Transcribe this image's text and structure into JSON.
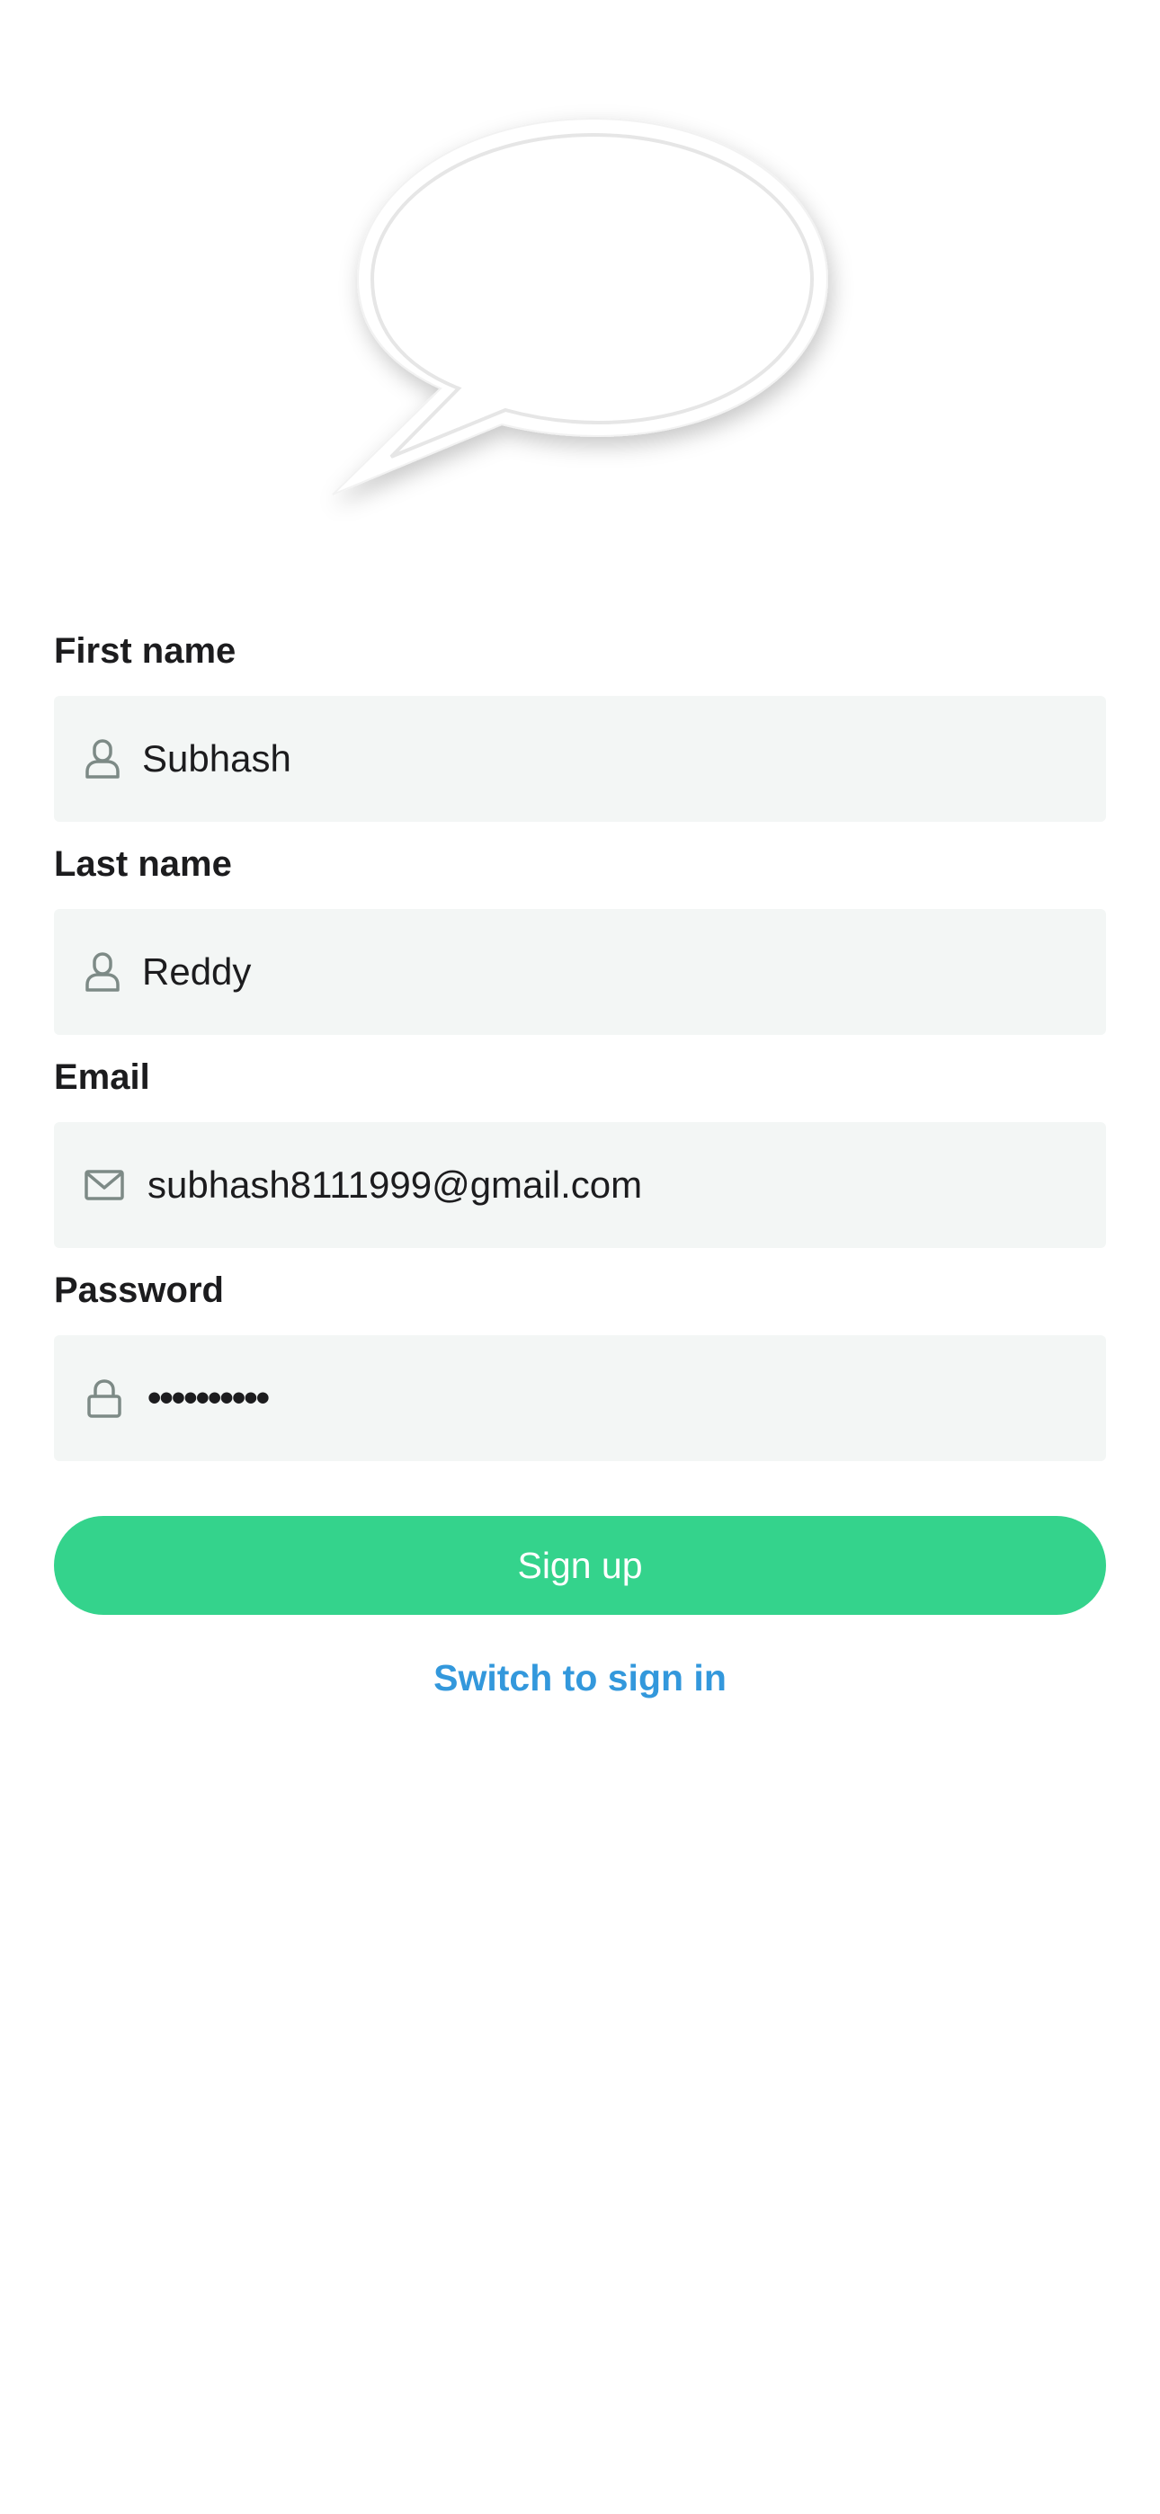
{
  "logo": {
    "icon": "speech-bubble-icon"
  },
  "form": {
    "first_name": {
      "label": "First name",
      "value": "Subhash",
      "icon": "user-icon"
    },
    "last_name": {
      "label": "Last name",
      "value": "Reddy",
      "icon": "user-icon"
    },
    "email": {
      "label": "Email",
      "value": "subhash8111999@gmail.com",
      "icon": "mail-icon"
    },
    "password": {
      "label": "Password",
      "value": "••••••••••",
      "icon": "lock-icon"
    }
  },
  "actions": {
    "signup_label": "Sign up",
    "switch_label": "Switch to sign in"
  },
  "colors": {
    "primary_green": "#34d38c",
    "link_blue": "#3398dc",
    "field_bg": "#f3f6f5",
    "icon_gray": "#7d8a86"
  }
}
